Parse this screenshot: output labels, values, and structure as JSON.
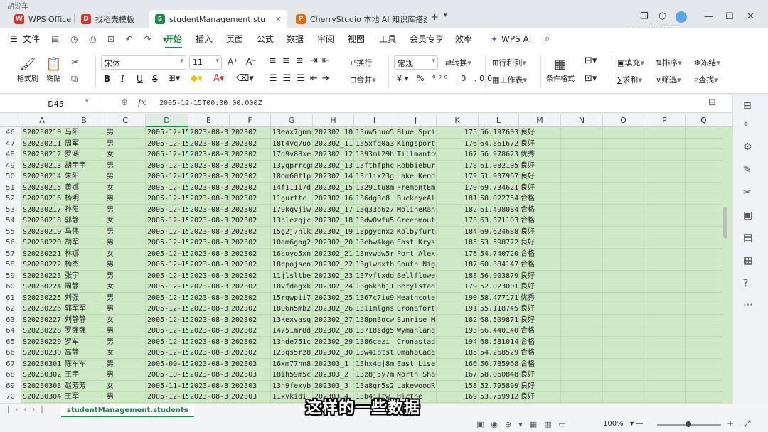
{
  "top_strip": "胡说车",
  "browser_tabs": [
    {
      "label": "WPS Office",
      "color": "#d9342b",
      "glyph": "W"
    },
    {
      "label": "找稻壳模板",
      "color": "#d9342b",
      "glyph": "D"
    },
    {
      "label": "studentManagement.stu",
      "color": "#1b8a4a",
      "glyph": "S"
    },
    {
      "label": "CherryStudio 本地 AI 知识库搭建.p",
      "color": "#e8690b",
      "glyph": "P"
    }
  ],
  "new_tab": "+",
  "watermark": "AI-大模王",
  "share": "分享",
  "menu": {
    "file": "文件",
    "items": [
      "开始",
      "插入",
      "页面",
      "公式",
      "数据",
      "审阅",
      "视图",
      "工具",
      "会员专享",
      "效率",
      "WPS AI"
    ]
  },
  "ribbon": {
    "format_painter": "格式刷",
    "paste": "粘贴",
    "font": "宋体",
    "size": "11",
    "bold": "B",
    "italic": "I",
    "underline": "U",
    "wrap": "换行",
    "merge": "合并",
    "number_format": "常规",
    "convert": "转换",
    "rowcol": "行和列",
    "worksheet": "工作表",
    "cond_format": "条件格式",
    "fill": "填充",
    "sort": "排序",
    "freeze": "冻结",
    "sum": "求和",
    "filter": "筛选",
    "find": "查找"
  },
  "name_box": "D45",
  "fx": "fx",
  "formula": "2005-12-15T00:00:00.000Z",
  "columns": [
    "A",
    "B",
    "C",
    "D",
    "E",
    "F",
    "G",
    "H",
    "I",
    "J",
    "K",
    "L",
    "M",
    "N",
    "O",
    "P",
    "Q"
  ],
  "rows": [
    {
      "n": "46",
      "a": "S20230210",
      "b": "马阳",
      "c": "男",
      "d": "2005-12-15",
      "e": "2023-08-31",
      "f": "202302",
      "g": "13eax7gnmr",
      "h": "202302_10",
      "i": "13uw5huo5",
      "j": "Blue Spri",
      "k": "175",
      "l": "56.197603",
      "m": "良好"
    },
    {
      "n": "47",
      "a": "S20230211",
      "b": "周军",
      "c": "男",
      "d": "2005-12-15",
      "e": "2023-08-31",
      "f": "202302",
      "g": "18t4vq7uo",
      "h": "202302_11",
      "i": "135xfq0a3",
      "j": "Kingsport",
      "k": "176",
      "l": "64.861672",
      "m": "良好"
    },
    {
      "n": "48",
      "a": "S20230212",
      "b": "罗涵",
      "c": "女",
      "d": "2005-12-15",
      "e": "2023-08-31",
      "f": "202302",
      "g": "17q9v88xe",
      "h": "202302_12",
      "i": "1393ml29h",
      "j": "Tillmantow",
      "k": "167",
      "l": "56.978623",
      "m": "优秀"
    },
    {
      "n": "49",
      "a": "S20230213",
      "b": "胡宇宇",
      "c": "男",
      "d": "2005-12-15",
      "e": "2023-08-31",
      "f": "202302",
      "g": "13yqprrcgm",
      "h": "202302_13",
      "i": "13fthfphc",
      "j": "Robbiebur",
      "k": "178",
      "l": "61.082105",
      "m": "良好"
    },
    {
      "n": "50",
      "a": "S20230214",
      "b": "朱阳",
      "c": "男",
      "d": "2005-12-15",
      "e": "2023-08-31",
      "f": "202302",
      "g": "18om60f1p",
      "h": "202302_14",
      "i": "13r1ix23g",
      "j": "Lake Kend",
      "k": "179",
      "l": "51.937967",
      "m": "良好"
    },
    {
      "n": "51",
      "a": "S20230215",
      "b": "黄娜",
      "c": "女",
      "d": "2005-12-15",
      "e": "2023-08-31",
      "f": "202302",
      "g": "14f111i7d",
      "h": "202302_15",
      "i": "13291tu8m",
      "j": "FremontEmi",
      "k": "170",
      "l": "69.734621",
      "m": "良好"
    },
    {
      "n": "52",
      "a": "S20230216",
      "b": "杨明",
      "c": "男",
      "d": "2005-12-15",
      "e": "2023-08-31",
      "f": "202302",
      "g": "11gurttc",
      "h": "202302_16",
      "i": "136dg3c8",
      "j": "BuckeyeAli",
      "k": "181",
      "l": "58.022754",
      "m": "合格"
    },
    {
      "n": "53",
      "a": "S20230217",
      "b": "孙阳",
      "c": "男",
      "d": "2005-12-15",
      "e": "2023-08-31",
      "f": "202302",
      "g": "179kqvjiw",
      "h": "202302_17",
      "i": "13q33o6z7",
      "j": "MolineRanc",
      "k": "182",
      "l": "61.498084",
      "m": "合格"
    },
    {
      "n": "54",
      "a": "S20230218",
      "b": "郭静",
      "c": "女",
      "d": "2005-12-15",
      "e": "2023-08-31",
      "f": "202302",
      "g": "13nlezqjc",
      "h": "202302_18",
      "i": "13dw0wfu5",
      "j": "Greenmouth",
      "k": "173",
      "l": "63.371103",
      "m": "合格"
    },
    {
      "n": "55",
      "a": "S20230219",
      "b": "马伟",
      "c": "男",
      "d": "2005-12-15",
      "e": "2023-08-31",
      "f": "202302",
      "g": "15g2j7nlki",
      "h": "202302_19",
      "i": "13pgycnxz",
      "j": "KolbyfurtC",
      "k": "184",
      "l": "69.624688",
      "m": "良好"
    },
    {
      "n": "56",
      "a": "S20230220",
      "b": "胡军",
      "c": "男",
      "d": "2005-12-15",
      "e": "2023-08-31",
      "f": "202302",
      "g": "10am6gag2",
      "h": "202302_20",
      "i": "13ebw4kga",
      "j": "East Kryst",
      "k": "185",
      "l": "53.598772",
      "m": "良好"
    },
    {
      "n": "57",
      "a": "S20230221",
      "b": "林娜",
      "c": "女",
      "d": "2005-12-15",
      "e": "2023-08-31",
      "f": "202302",
      "g": "16soyo5xn",
      "h": "202302_21",
      "i": "13nvwdw5r",
      "j": "Port Alexi",
      "k": "176",
      "l": "54.740720",
      "m": "合格"
    },
    {
      "n": "58",
      "a": "S20230222",
      "b": "杨杰",
      "c": "男",
      "d": "2005-12-15",
      "e": "2023-08-31",
      "f": "202302",
      "g": "18cpojsen",
      "h": "202302_22",
      "i": "13giwaxth",
      "j": "South Nige",
      "k": "187",
      "l": "60.384147",
      "m": "合格"
    },
    {
      "n": "59",
      "a": "S20230223",
      "b": "张宇",
      "c": "男",
      "d": "2005-12-15",
      "e": "2023-08-31",
      "f": "202302",
      "g": "11jlsltbe",
      "h": "202302_23",
      "i": "137yftxdd",
      "j": "Bellflower",
      "k": "188",
      "l": "56.903879",
      "m": "良好"
    },
    {
      "n": "60",
      "a": "S20230224",
      "b": "周静",
      "c": "女",
      "d": "2005-12-15",
      "e": "2023-08-31",
      "f": "202302",
      "g": "10vfdagxk",
      "h": "202302_24",
      "i": "13g6knhj1",
      "j": "Berylstad",
      "k": "179",
      "l": "52.023001",
      "m": "良好"
    },
    {
      "n": "61",
      "a": "S20230225",
      "b": "刘强",
      "c": "男",
      "d": "2005-12-15",
      "e": "2023-08-31",
      "f": "202302",
      "g": "15rqwpii7",
      "h": "202302_25",
      "i": "1367c7iu9",
      "j": "Heathcote",
      "k": "190",
      "l": "58.477171",
      "m": "优秀"
    },
    {
      "n": "62",
      "a": "S20230226",
      "b": "郭军军",
      "c": "男",
      "d": "2005-12-15",
      "e": "2023-08-31",
      "f": "202302",
      "g": "1806n5mb2",
      "h": "202302_26",
      "i": "13i1mlgns",
      "j": "CronafortS",
      "k": "191",
      "l": "55.118745",
      "m": "良好"
    },
    {
      "n": "63",
      "a": "S20230227",
      "b": "刘静静",
      "c": "女",
      "d": "2005-12-15",
      "e": "2023-08-31",
      "f": "202302",
      "g": "13kexvasq",
      "h": "202302_27",
      "i": "138pn3ocw",
      "j": "Sunrise Ma",
      "k": "182",
      "l": "68.509871",
      "m": "良好"
    },
    {
      "n": "64",
      "a": "S20230228",
      "b": "罗强强",
      "c": "男",
      "d": "2005-12-15",
      "e": "2023-08-31",
      "f": "202302",
      "g": "14751mr8d",
      "h": "202302_28",
      "i": "13718sdg5",
      "j": "WymanlandF",
      "k": "193",
      "l": "66.440140",
      "m": "合格"
    },
    {
      "n": "65",
      "a": "S20230229",
      "b": "罗军",
      "c": "男",
      "d": "2005-12-15",
      "e": "2023-08-31",
      "f": "202302",
      "g": "13hde751c",
      "h": "202302_29",
      "i": "1386cezi",
      "j": "Cronastad",
      "k": "194",
      "l": "68.581014",
      "m": "合格"
    },
    {
      "n": "66",
      "a": "S20230230",
      "b": "高静",
      "c": "女",
      "d": "2005-12-15",
      "e": "2023-08-31",
      "f": "202302",
      "g": "123qs5rz8",
      "h": "202302_30",
      "i": "13w4iptst",
      "j": "OmahaCade",
      "k": "185",
      "l": "54.268529",
      "m": "合格"
    },
    {
      "n": "67",
      "a": "S20230301",
      "b": "陈军军",
      "c": "男",
      "d": "2005-09-15",
      "e": "2023-08-31",
      "f": "202303",
      "g": "16xm77hn8",
      "h": "202303_1",
      "i": "13hx4qj8m",
      "j": "East Liset",
      "k": "166",
      "l": "56.785968",
      "m": "合格"
    },
    {
      "n": "68",
      "a": "S20230302",
      "b": "王宇",
      "c": "男",
      "d": "2005-10-15",
      "e": "2023-08-31",
      "f": "202303",
      "g": "18ih59m5c",
      "h": "202303_2",
      "i": "13z8j5y7m",
      "j": "North Shad",
      "k": "167",
      "l": "58.060848",
      "m": "良好"
    },
    {
      "n": "69",
      "a": "S20230303",
      "b": "赵芳芳",
      "c": "女",
      "d": "2005-11-15",
      "e": "2023-08-31",
      "f": "202303",
      "g": "13h9fexyb",
      "h": "202303_3",
      "i": "13a8gr5s2",
      "j": "LakewoodRi",
      "k": "158",
      "l": "52.795899",
      "m": "良好"
    },
    {
      "n": "70",
      "a": "S20230304",
      "b": "王军",
      "c": "男",
      "d": "2005-12-15",
      "e": "2023-08-31",
      "f": "202303",
      "g": "11xvkidi",
      "h": "202303_4",
      "i": "13b4jitw",
      "j": "Hirthe",
      "k": "169",
      "l": "53.759912",
      "m": "良好"
    }
  ],
  "sheet_tab": "studentManagement.students",
  "add_sheet": "+",
  "zoom": "100%",
  "subtitle": "这样的一些数据"
}
